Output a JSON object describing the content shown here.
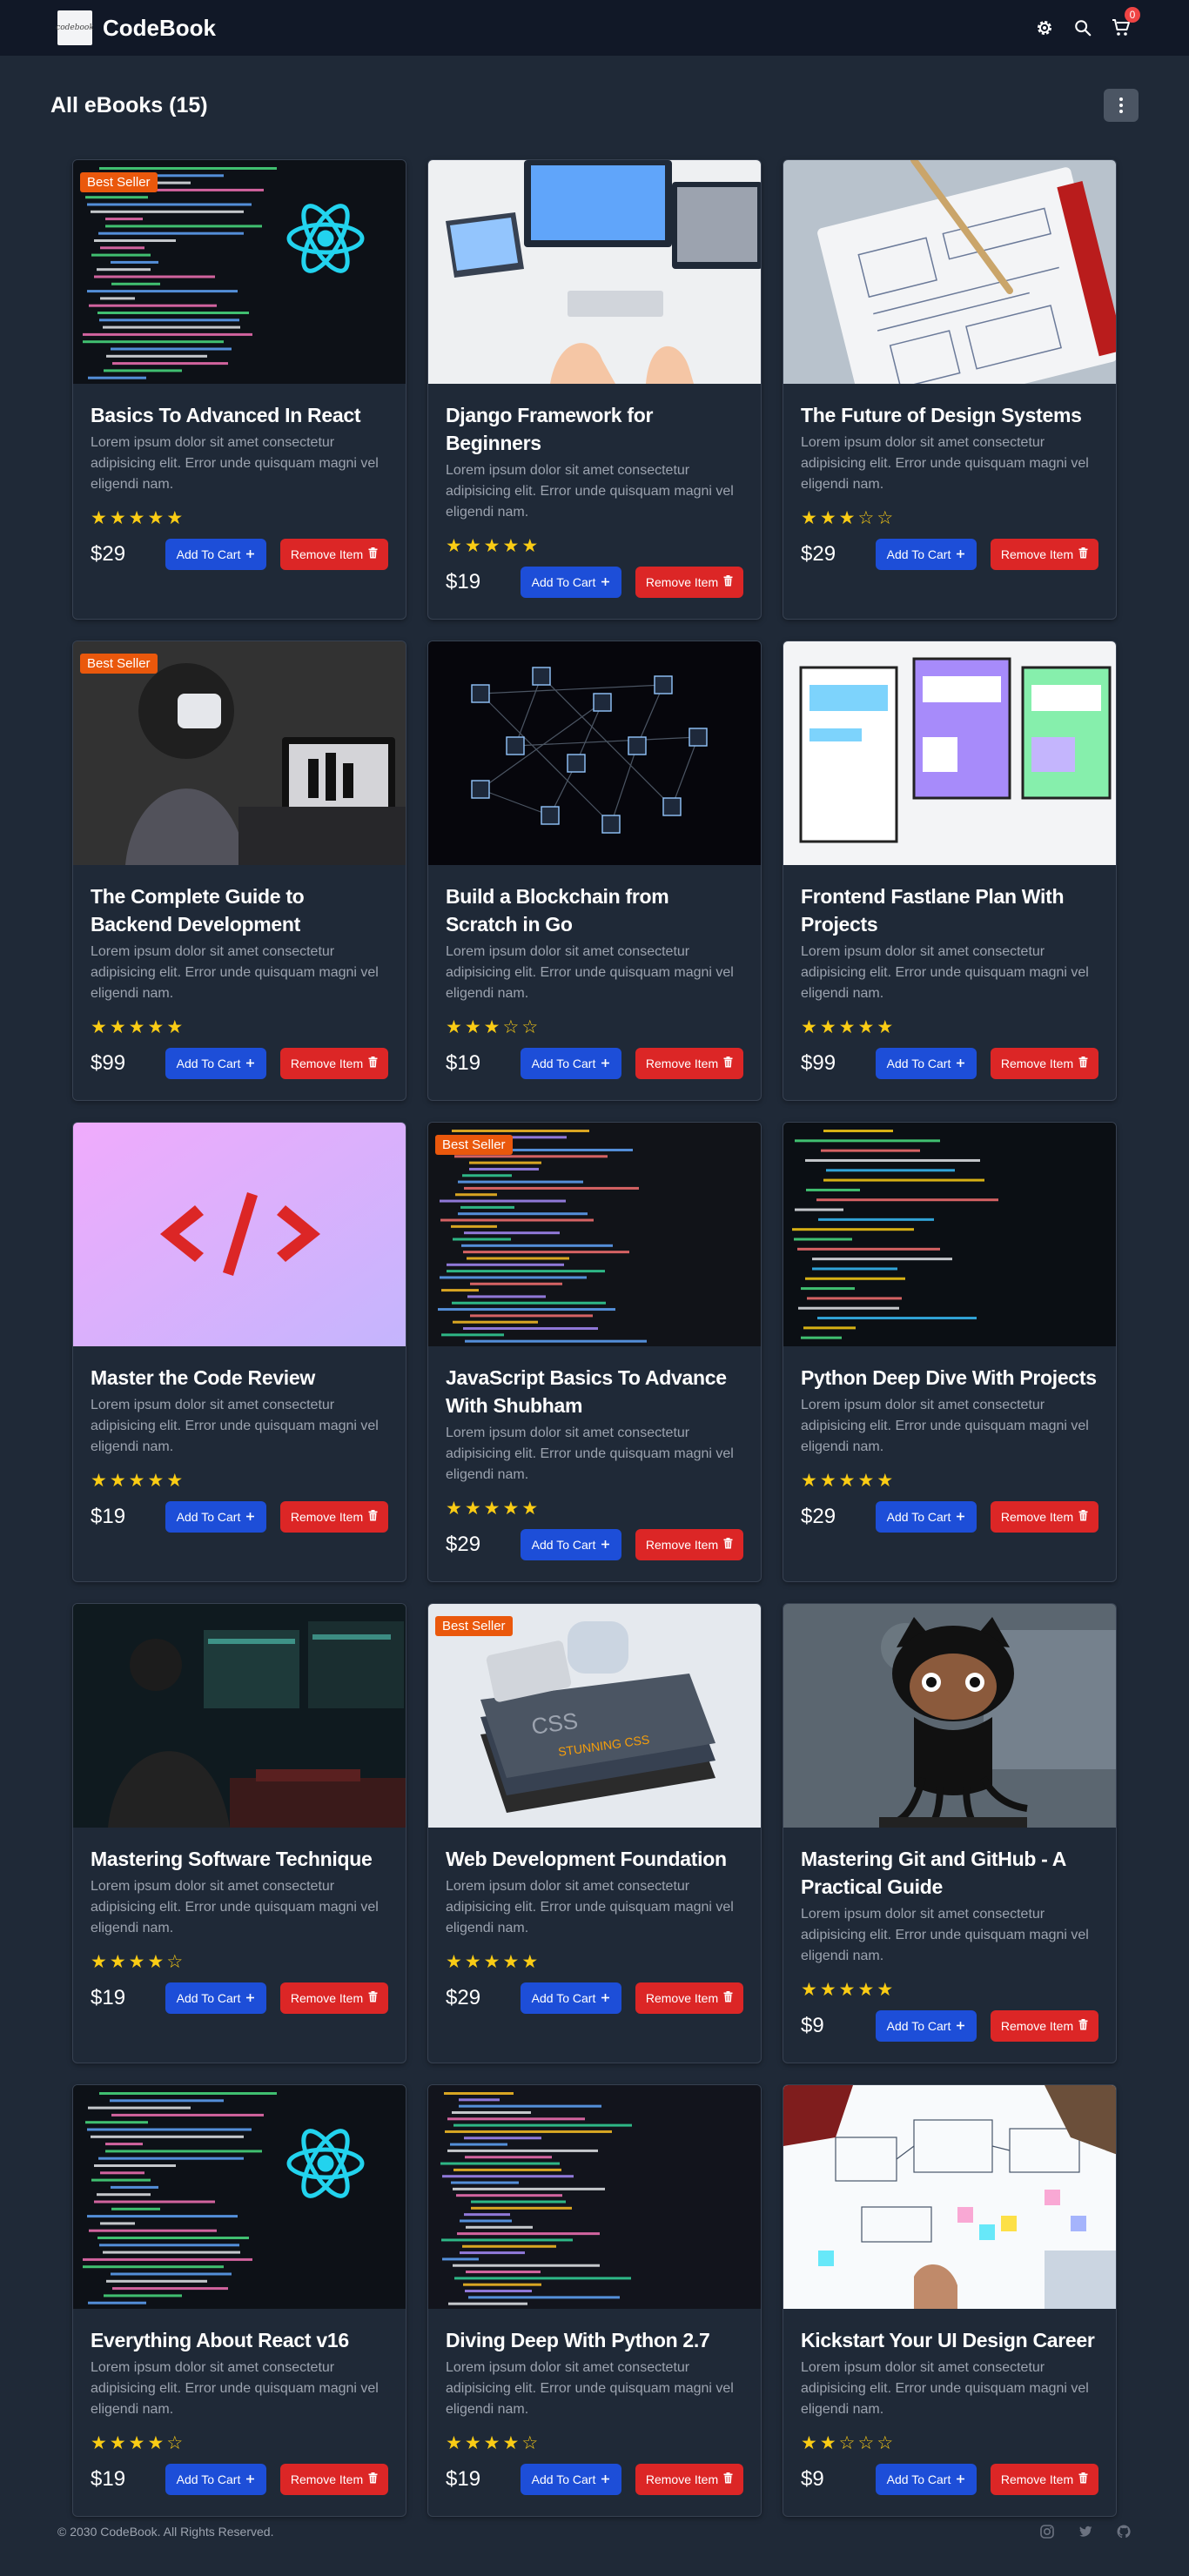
{
  "brand": {
    "name": "CodeBook",
    "logo_text": "codebook"
  },
  "nav": {
    "cart_count": "0"
  },
  "page": {
    "title": "All eBooks (15)"
  },
  "products": [
    {
      "title": "Basics To Advanced In React",
      "desc": "Lorem ipsum dolor sit amet consectetur adipisicing elit. Error unde quisquam magni vel eligendi nam.",
      "price": "$29",
      "rating": 5,
      "best_seller": true,
      "image": "react"
    },
    {
      "title": "Django Framework for Beginners",
      "desc": "Lorem ipsum dolor sit amet consectetur adipisicing elit. Error unde quisquam magni vel eligendi nam.",
      "price": "$19",
      "rating": 5,
      "best_seller": false,
      "image": "desk"
    },
    {
      "title": "The Future of Design Systems",
      "desc": "Lorem ipsum dolor sit amet consectetur adipisicing elit. Error unde quisquam magni vel eligendi nam.",
      "price": "$29",
      "rating": 3,
      "best_seller": false,
      "image": "sketch"
    },
    {
      "title": "The Complete Guide to Backend Development",
      "desc": "Lorem ipsum dolor sit amet consectetur adipisicing elit. Error unde quisquam magni vel eligendi nam.",
      "price": "$99",
      "rating": 5,
      "best_seller": true,
      "image": "vr"
    },
    {
      "title": "Build a Blockchain from Scratch in Go",
      "desc": "Lorem ipsum dolor sit amet consectetur adipisicing elit. Error unde quisquam magni vel eligendi nam.",
      "price": "$19",
      "rating": 3,
      "best_seller": false,
      "image": "blockchain"
    },
    {
      "title": "Frontend Fastlane Plan With Projects",
      "desc": "Lorem ipsum dolor sit amet consectetur adipisicing elit. Error unde quisquam magni vel eligendi nam.",
      "price": "$99",
      "rating": 5,
      "best_seller": false,
      "image": "wireframe"
    },
    {
      "title": "Master the Code Review",
      "desc": "Lorem ipsum dolor sit amet consectetur adipisicing elit. Error unde quisquam magni vel eligendi nam.",
      "price": "$19",
      "rating": 5,
      "best_seller": false,
      "image": "codetag"
    },
    {
      "title": "JavaScript Basics To Advance With Shubham",
      "desc": "Lorem ipsum dolor sit amet consectetur adipisicing elit. Error unde quisquam magni vel eligendi nam.",
      "price": "$29",
      "rating": 5,
      "best_seller": true,
      "image": "jscode"
    },
    {
      "title": "Python Deep Dive With Projects",
      "desc": "Lorem ipsum dolor sit amet consectetur adipisicing elit. Error unde quisquam magni vel eligendi nam.",
      "price": "$29",
      "rating": 5,
      "best_seller": false,
      "image": "pycode"
    },
    {
      "title": "Mastering Software Technique",
      "desc": "Lorem ipsum dolor sit amet consectetur adipisicing elit. Error unde quisquam magni vel eligendi nam.",
      "price": "$19",
      "rating": 4,
      "best_seller": false,
      "image": "darkdesk"
    },
    {
      "title": "Web Development Foundation",
      "desc": "Lorem ipsum dolor sit amet consectetur adipisicing elit. Error unde quisquam magni vel eligendi nam.",
      "price": "$29",
      "rating": 5,
      "best_seller": true,
      "image": "books"
    },
    {
      "title": "Mastering Git and GitHub - A Practical Guide",
      "desc": "Lorem ipsum dolor sit amet consectetur adipisicing elit. Error unde quisquam magni vel eligendi nam.",
      "price": "$9",
      "rating": 5,
      "best_seller": false,
      "image": "octocat"
    },
    {
      "title": "Everything About React v16",
      "desc": "Lorem ipsum dolor sit amet consectetur adipisicing elit. Error unde quisquam magni vel eligendi nam.",
      "price": "$19",
      "rating": 4,
      "best_seller": false,
      "image": "react"
    },
    {
      "title": "Diving Deep With Python 2.7",
      "desc": "Lorem ipsum dolor sit amet consectetur adipisicing elit. Error unde quisquam magni vel eligendi nam.",
      "price": "$19",
      "rating": 4,
      "best_seller": false,
      "image": "pycode2"
    },
    {
      "title": "Kickstart Your UI Design Career",
      "desc": "Lorem ipsum dolor sit amet consectetur adipisicing elit. Error unde quisquam magni vel eligendi nam.",
      "price": "$9",
      "rating": 2,
      "best_seller": false,
      "image": "uiteam"
    }
  ],
  "labels": {
    "best_seller": "Best Seller",
    "add_to_cart": "Add To Cart",
    "remove_item": "Remove Item"
  },
  "footer": {
    "copyright": "© 2030 CodeBook. All Rights Reserved."
  },
  "colors": {
    "navbar": "#111827",
    "background": "#1f2937",
    "cart_button": "#1d4ed8",
    "remove_button": "#dc2626",
    "badge": "#ea580c",
    "star": "#facc15"
  }
}
